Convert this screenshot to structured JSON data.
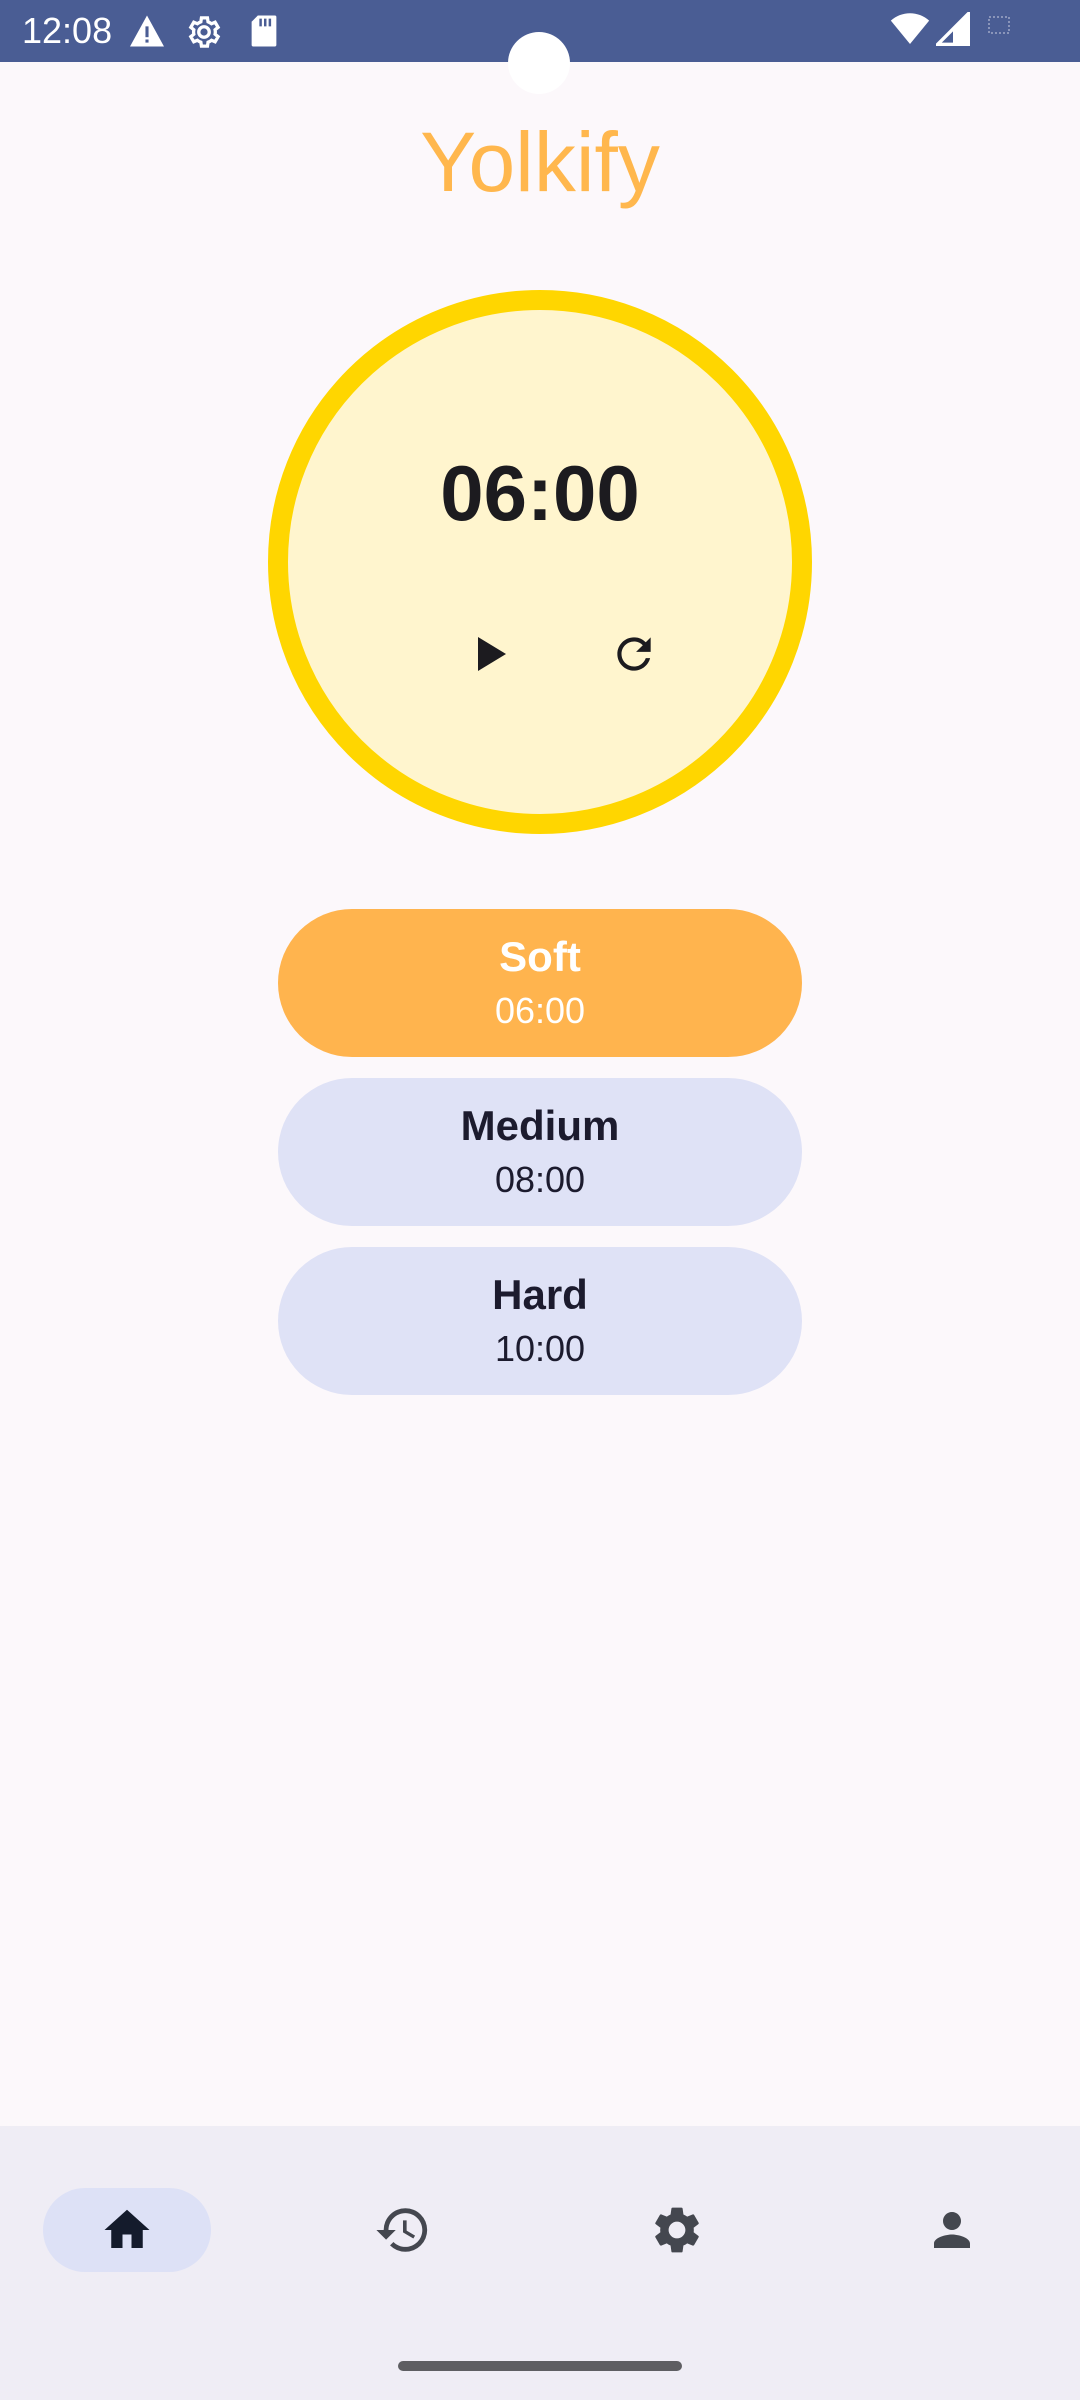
{
  "status_bar": {
    "time": "12:08",
    "icons": [
      "warning-icon",
      "settings-gear-icon",
      "sd-card-icon",
      "wifi-icon",
      "cell-signal-icon"
    ],
    "color": "#4A5D94"
  },
  "app": {
    "title": "Yolkify",
    "title_color": "#FFB74D"
  },
  "timer": {
    "display": "06:00",
    "ring_color": "#FFD600",
    "fill_color": "#FFF5CE",
    "controls": [
      "play-icon",
      "reset-icon"
    ]
  },
  "presets": [
    {
      "name": "Soft",
      "time": "06:00",
      "selected": true
    },
    {
      "name": "Medium",
      "time": "08:00",
      "selected": false
    },
    {
      "name": "Hard",
      "time": "10:00",
      "selected": false
    }
  ],
  "colors": {
    "preset_selected": "#FFB44E",
    "preset_default": "#DFE2F6",
    "nav_background": "#EFEDF5"
  },
  "bottom_nav": {
    "items": [
      {
        "icon": "home-icon",
        "selected": true
      },
      {
        "icon": "history-icon",
        "selected": false
      },
      {
        "icon": "settings-icon",
        "selected": false
      },
      {
        "icon": "profile-icon",
        "selected": false
      }
    ]
  }
}
